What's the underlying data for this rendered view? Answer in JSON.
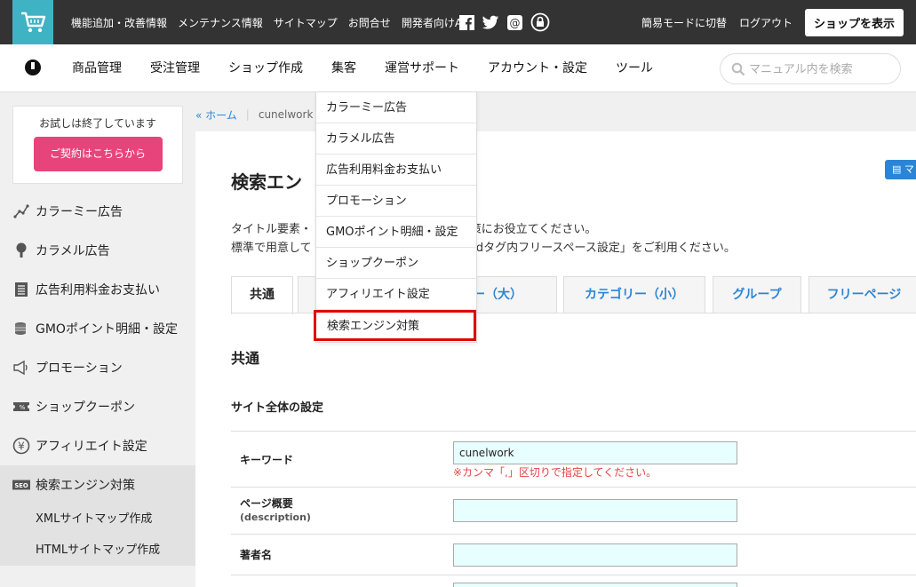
{
  "topbar": {
    "links": [
      "機能追加・改善情報",
      "メンテナンス情報",
      "サイトマップ",
      "お問合せ",
      "開発者向けAPI"
    ],
    "social_icons": [
      "facebook-icon",
      "twitter-icon",
      "email-icon",
      "lock-icon"
    ],
    "right_links": [
      "簡易モードに切替",
      "ログアウト"
    ],
    "shop_button": "ショップを表示",
    "accent_color": "#3fb3c4"
  },
  "nav": {
    "items": [
      "商品管理",
      "受注管理",
      "ショップ作成",
      "集客",
      "運営サポート",
      "アカウント・設定",
      "ツール"
    ],
    "search_placeholder": "マニュアル内を検索"
  },
  "sidebar": {
    "trial_text": "お試しは終了しています",
    "contract_button": "ご契約はこちらから",
    "items": [
      {
        "label": "カラーミー広告",
        "icon": "chart-icon"
      },
      {
        "label": "カラメル広告",
        "icon": "pin-icon"
      },
      {
        "label": "広告利用料金お支払い",
        "icon": "invoice-icon"
      },
      {
        "label": "GMOポイント明細・設定",
        "icon": "coins-icon"
      },
      {
        "label": "プロモーション",
        "icon": "megaphone-icon"
      },
      {
        "label": "ショップクーポン",
        "icon": "coupon-icon"
      },
      {
        "label": "アフィリエイト設定",
        "icon": "yen-icon"
      },
      {
        "label": "検索エンジン対策",
        "icon": "seo-icon"
      }
    ],
    "subitems": [
      "XMLサイトマップ作成",
      "HTMLサイトマップ作成"
    ]
  },
  "breadcrumb": {
    "home": "« ホーム",
    "current": "cunelwork"
  },
  "dropdown": {
    "items": [
      "カラーミー広告",
      "カラメル広告",
      "広告利用料金お支払い",
      "プロモーション",
      "GMOポイント明細・設定",
      "ショップクーポン",
      "アフィリエイト設定",
      "検索エンジン対策"
    ],
    "highlight_color": "#e00000"
  },
  "main": {
    "title": "検索エン",
    "manual_button": "マ",
    "desc1_left": "タイトル要素・",
    "desc1_right": "SEO対策にお役立てください。",
    "desc2_left": "標準で用意して",
    "desc2_right": "には「headタグ内フリースペース設定」をご利用ください。",
    "tabs": [
      "共通",
      "リー（大）",
      "カテゴリー（小）",
      "グループ",
      "フリーページ"
    ],
    "section_heading": "共通",
    "sub_heading": "サイト全体の設定",
    "form": {
      "keyword_label": "キーワード",
      "keyword_value": "cunelwork",
      "keyword_hint": "※カンマ「,」区切りで指定してください。",
      "description_label": "ページ概要",
      "description_sub": "(description)",
      "description_value": "",
      "author_label": "著者名",
      "author_value": ""
    }
  }
}
